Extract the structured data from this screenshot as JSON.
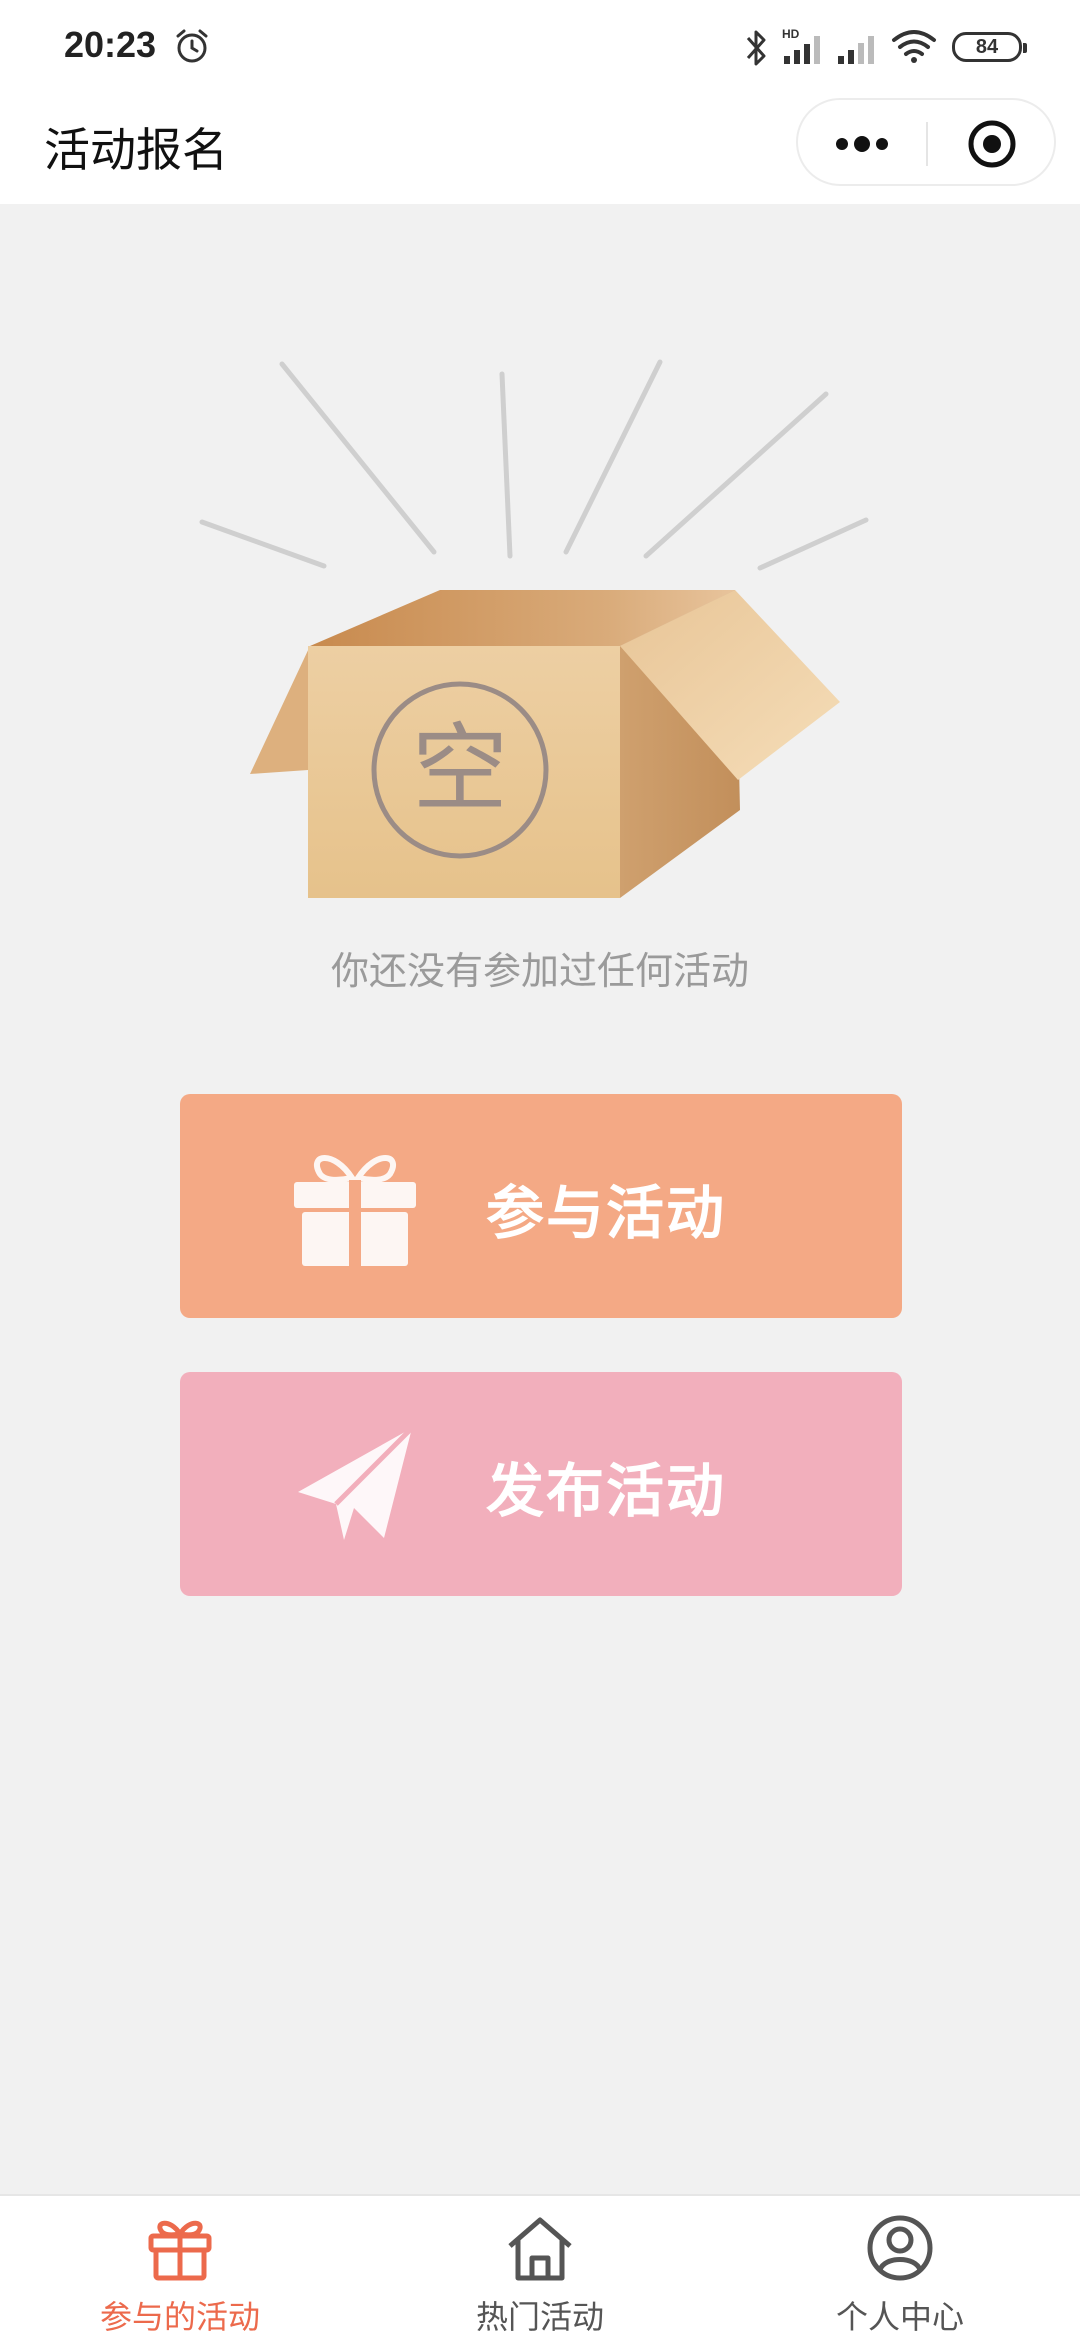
{
  "status_bar": {
    "time": "20:23",
    "battery": "84",
    "icons": [
      "alarm-icon",
      "bluetooth-icon",
      "signal-hd-icon",
      "signal-icon",
      "wifi-icon",
      "battery-icon"
    ]
  },
  "nav": {
    "title": "活动报名",
    "icons": [
      "more-icon",
      "close-target-icon"
    ]
  },
  "empty_state": {
    "badge": "空",
    "message": "你还没有参加过任何活动",
    "icon": "open-box-icon"
  },
  "actions": [
    {
      "label": "参与活动",
      "icon": "gift-icon",
      "color": "#f4a985"
    },
    {
      "label": "发布活动",
      "icon": "paper-plane-icon",
      "color": "#f2afbc"
    }
  ],
  "tabs": [
    {
      "label": "参与的活动",
      "icon": "gift-icon",
      "active": true
    },
    {
      "label": "热门活动",
      "icon": "home-icon",
      "active": false
    },
    {
      "label": "个人中心",
      "icon": "user-icon",
      "active": false
    }
  ],
  "colors": {
    "accent": "#ec6a4c",
    "background": "#f1f1f1"
  }
}
